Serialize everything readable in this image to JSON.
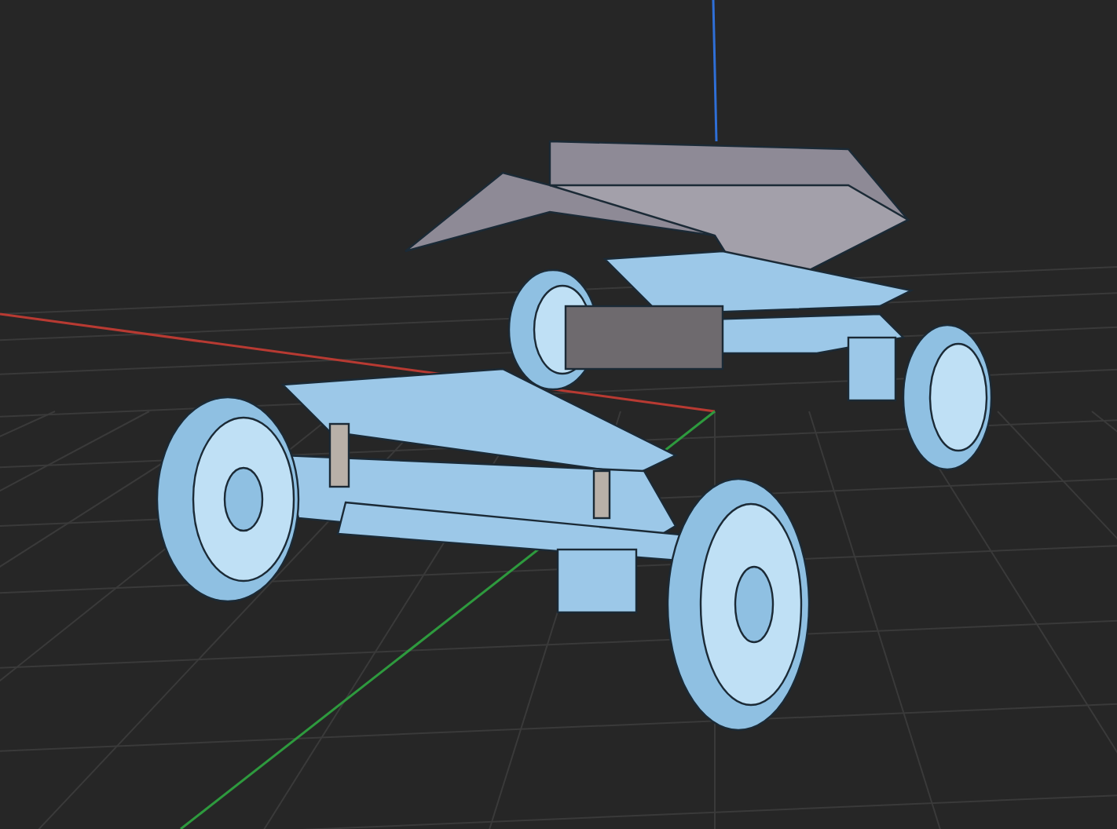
{
  "viewport": {
    "axes": [
      {
        "kind": "x",
        "color": "#b83a32"
      },
      {
        "kind": "y",
        "color": "#2e9a3e"
      },
      {
        "kind": "z",
        "color": "#2f6fd6"
      }
    ]
  }
}
